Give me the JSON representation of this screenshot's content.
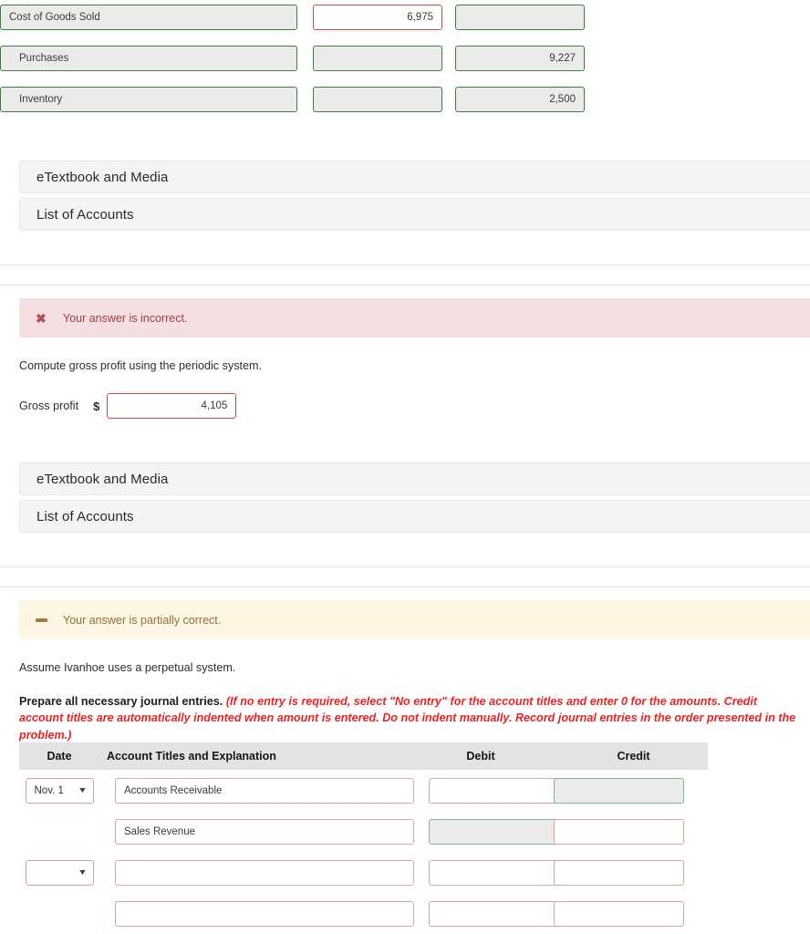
{
  "periodic_section": {
    "account_rows": [
      {
        "name": "Cost of Goods Sold",
        "indent": 0,
        "debit": "6,975",
        "credit": ""
      },
      {
        "name": "Purchases",
        "indent": 1,
        "debit": "",
        "credit": "9,227"
      },
      {
        "name": "Inventory",
        "indent": 1,
        "debit": "",
        "credit": "2,500"
      }
    ],
    "links": [
      {
        "label": "eTextbook and Media"
      },
      {
        "label": "List of Accounts"
      }
    ]
  },
  "gross_profit_section": {
    "banner": {
      "icon": "x-mark-icon",
      "text": "Your answer is incorrect."
    },
    "instruction": "Compute gross profit using the periodic system.",
    "gross_profit_label": "Gross profit",
    "currency_symbol": "$",
    "gross_profit_value": "4,105",
    "links": [
      {
        "label": "eTextbook and Media"
      },
      {
        "label": "List of Accounts"
      }
    ]
  },
  "perpetual_section": {
    "banner": {
      "icon": "dash-icon",
      "text": "Your answer is partially correct."
    },
    "assume_text": "Assume Ivanhoe uses a perpetual system.",
    "prepare_lead": "Prepare all necessary journal entries.",
    "prepare_hint": "(If no entry is required, select \"No entry\" for the account titles and enter 0 for the amounts. Credit account titles are automatically indented when amount is entered. Do not indent manually. Record journal entries in the order presented in the problem.)",
    "table": {
      "headers": {
        "date": "Date",
        "account": "Account Titles and Explanation",
        "debit": "Debit",
        "credit": "Credit"
      },
      "rows": [
        {
          "date_value": "Nov. 1",
          "has_date_select": true,
          "account": "Accounts Receivable",
          "account_state": "active",
          "debit": "",
          "debit_state": "active",
          "credit": "",
          "credit_state": "disabled"
        },
        {
          "date_value": "",
          "has_date_select": false,
          "account": "Sales Revenue",
          "account_state": "active",
          "debit": "",
          "debit_state": "disabled",
          "credit": "",
          "credit_state": "active"
        },
        {
          "date_value": "",
          "has_date_select": true,
          "account": "",
          "account_state": "active",
          "debit": "",
          "debit_state": "active",
          "credit": "",
          "credit_state": "active"
        },
        {
          "date_value": "",
          "has_date_select": false,
          "account": "",
          "account_state": "active",
          "debit": "",
          "debit_state": "active",
          "credit": "",
          "credit_state": "active"
        }
      ]
    }
  },
  "colors": {
    "error_banner_bg": "#f4dfe2",
    "error_banner_text": "#a23d48",
    "partial_banner_bg": "#fdf6e3",
    "partial_banner_text": "#8d7336",
    "hint_red": "#ee2222",
    "field_green": "#3f7d46",
    "field_red": "#c0504d",
    "disabled_bg": "#ebebeb",
    "grey_bar_bg": "#f4f4f5",
    "table_header_bg": "#e3e3e3"
  }
}
